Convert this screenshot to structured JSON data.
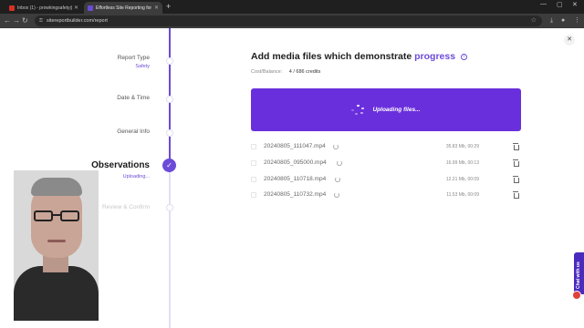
{
  "browser": {
    "tabs": [
      {
        "title": "Inbox (1) - prowkingsafety@g..."
      },
      {
        "title": "Effortless Site Reporting for co..."
      }
    ],
    "new_tab": "+",
    "url": "sitereportbuilder.com/report"
  },
  "steps": [
    {
      "label": "Report Type",
      "sub": "Safety"
    },
    {
      "label": "Date & Time"
    },
    {
      "label": "General Info"
    },
    {
      "label": "Observations",
      "sub": "Uploading...",
      "current": true
    },
    {
      "label": "Review & Confirm"
    }
  ],
  "main": {
    "heading_prefix": "Add media files which demonstrate",
    "heading_accent": "progress",
    "cost_label": "Cost/Balance:",
    "cost_value": "4 / 686 credits",
    "upload_text": "Uploading files..."
  },
  "files": [
    {
      "name": "20240805_111047.mp4",
      "meta": "35.83 Mb, 00:29"
    },
    {
      "name": "20240805_095000.mp4",
      "meta": "16.99 Mb, 00:13"
    },
    {
      "name": "20240805_110718.mp4",
      "meta": "12.21 Mb, 00:09"
    },
    {
      "name": "20240805_110732.mp4",
      "meta": "11.53 Mb, 00:09"
    }
  ],
  "chat": {
    "label": "Chat with us"
  },
  "colors": {
    "accent": "#6c4bd8",
    "upload_bg": "#6a2fdc",
    "chat_bg": "#4b2bbd"
  },
  "icons": [
    "gmail-icon",
    "site-icon",
    "back-icon",
    "forward-icon",
    "reload-icon",
    "lock-icon",
    "star-icon",
    "download-icon",
    "extension-icon",
    "menu-icon",
    "info-icon",
    "close-icon",
    "check-icon",
    "spinner-icon",
    "trash-icon"
  ]
}
